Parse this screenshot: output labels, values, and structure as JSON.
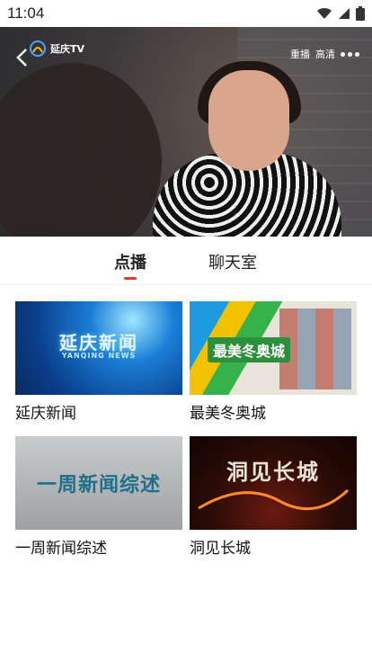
{
  "status": {
    "time": "11:04"
  },
  "player": {
    "logo_text": "延庆TV",
    "replay_label": "重播",
    "quality_label": "高清"
  },
  "tabs": [
    {
      "label": "点播",
      "active": true
    },
    {
      "label": "聊天室",
      "active": false
    }
  ],
  "programs": [
    {
      "title": "延庆新闻",
      "thumb_text": "延庆新闻",
      "thumb_sub": "YANQING NEWS"
    },
    {
      "title": "最美冬奥城",
      "thumb_text": "最美冬奥城"
    },
    {
      "title": "一周新闻综述",
      "thumb_text": "一周新闻综述"
    },
    {
      "title": "洞见长城",
      "thumb_text": "洞见长城"
    }
  ],
  "colors": {
    "accent": "#e23b2f"
  }
}
